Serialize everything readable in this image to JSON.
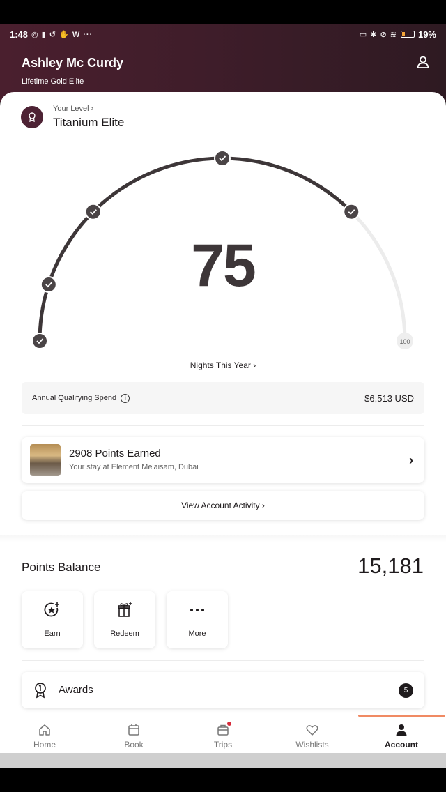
{
  "status_bar": {
    "time": "1:48",
    "left_icons": "◎ ▮ ↺ ✋ W ···",
    "right_icons": "▭ ✱ ⊘ ≋",
    "battery": "19%"
  },
  "header": {
    "name": "Ashley Mc Curdy",
    "tier": "Lifetime Gold Elite",
    "profile_icon": "user-icon"
  },
  "level": {
    "label": "Your Level",
    "name": "Titanium Elite"
  },
  "gauge": {
    "nights": "75",
    "max_label": "100",
    "progress": 0.75,
    "checkpoints": [
      0,
      0.1,
      0.25,
      0.5,
      0.75
    ]
  },
  "nights_link": "Nights This Year",
  "spend": {
    "label": "Annual Qualifying Spend",
    "value": "$6,513 USD"
  },
  "points_earned": {
    "title": "2908 Points Earned",
    "subtitle": "Your stay at Element Me'aisam, Dubai"
  },
  "activity_button": "View Account Activity",
  "balance": {
    "label": "Points Balance",
    "value": "15,181"
  },
  "actions": [
    {
      "label": "Earn",
      "icon": "star-plus-icon"
    },
    {
      "label": "Redeem",
      "icon": "gift-icon"
    },
    {
      "label": "More",
      "icon": "more-dots-icon"
    }
  ],
  "awards": {
    "label": "Awards",
    "count": "5"
  },
  "nav": [
    {
      "label": "Home",
      "icon": "home-icon"
    },
    {
      "label": "Book",
      "icon": "calendar-icon"
    },
    {
      "label": "Trips",
      "icon": "suitcase-icon"
    },
    {
      "label": "Wishlists",
      "icon": "heart-icon"
    },
    {
      "label": "Account",
      "icon": "account-icon"
    }
  ],
  "colors": {
    "header": "#4a1f2e",
    "gauge": "#3d3638",
    "accent": "#f08a63",
    "notification": "#d62b3a"
  }
}
